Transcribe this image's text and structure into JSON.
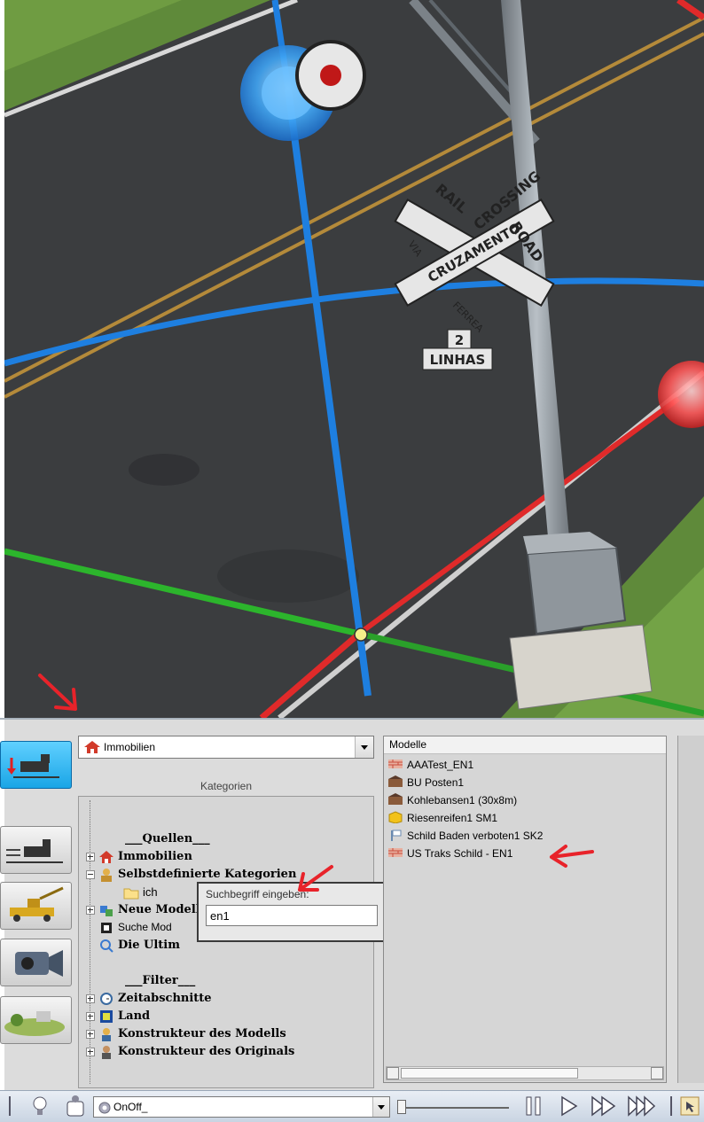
{
  "viewport": {
    "sign": {
      "line1": "RAIL",
      "line2": "ROAD",
      "line3": "CROSSING",
      "pt1": "VIA",
      "pt2": "FERREA",
      "pt3": "CRUZAMENTO",
      "count": "2",
      "tracks": "LINHAS"
    }
  },
  "panel": {
    "category_select": "Immobilien",
    "categories_label": "Kategorien",
    "tree": [
      {
        "label": "___Quellen___",
        "bold": true
      },
      {
        "label": "Immobilien",
        "bold": true
      },
      {
        "label": "Selbstdefinierte Kategorien",
        "bold": true
      },
      {
        "label": "ich",
        "bold": false
      },
      {
        "label": "Neue Modelle",
        "bold": true
      },
      {
        "label": "Suche Mod",
        "bold": false
      },
      {
        "label": "Die Ultim",
        "bold": true
      },
      {
        "label": "___Filter___",
        "bold": true
      },
      {
        "label": "Zeitabschnitte",
        "bold": true
      },
      {
        "label": "Land",
        "bold": true
      },
      {
        "label": "Konstrukteur des Modells",
        "bold": true
      },
      {
        "label": "Konstrukteur des Originals",
        "bold": true
      }
    ],
    "search": {
      "caption": "Suchbegriff eingeben:",
      "value": "en1"
    },
    "models_header": "Modelle",
    "models": [
      {
        "label": "AAATest_EN1",
        "icon": "wall-icon"
      },
      {
        "label": "BU Posten1",
        "icon": "building-icon"
      },
      {
        "label": "Kohlebansen1 (30x8m)",
        "icon": "building-icon"
      },
      {
        "label": "Riesenreifen1 SM1",
        "icon": "box-icon"
      },
      {
        "label": "Schild Baden verboten1 SK2",
        "icon": "sign-icon"
      },
      {
        "label": "US  Traks  Schild - EN1",
        "icon": "wall-icon"
      }
    ]
  },
  "toolbar": {
    "onoff_select": "OnOff_"
  },
  "colors": {
    "active_tool": "#1aa5e6",
    "annotation_arrow": "#e8232a",
    "axis_blue": "#1e7fe0",
    "axis_green": "#2cb52c",
    "axis_red": "#e02a2a"
  }
}
